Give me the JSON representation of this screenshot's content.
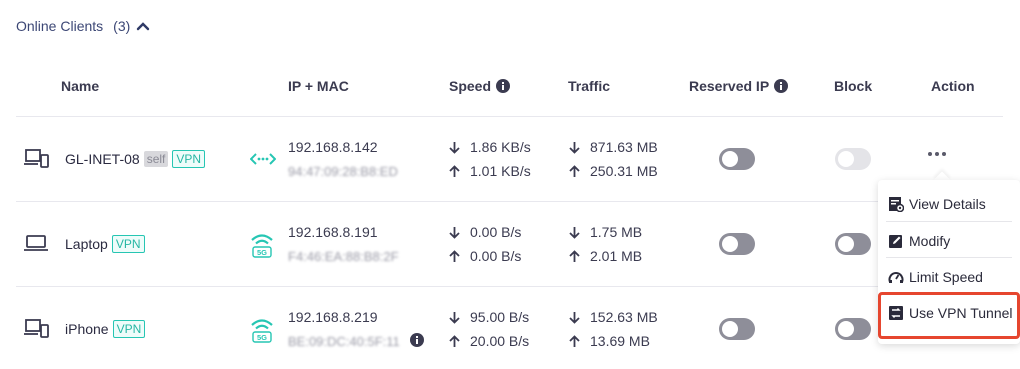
{
  "section": {
    "title": "Online Clients",
    "count": "(3)"
  },
  "columns": {
    "name": "Name",
    "ip_mac": "IP + MAC",
    "speed": "Speed",
    "traffic": "Traffic",
    "reserved_ip": "Reserved IP",
    "block": "Block",
    "action": "Action"
  },
  "clients": [
    {
      "device_type": "desktop-phone",
      "name": "GL-INET-08",
      "tags": [
        "self",
        "VPN"
      ],
      "connection": "lan",
      "ip": "192.168.8.142",
      "mac": "94:47:09:28:B8:ED",
      "speed_down": "1.86 KB/s",
      "speed_up": "1.01 KB/s",
      "traffic_down": "871.63 MB",
      "traffic_up": "250.31 MB",
      "reserved_ip": false,
      "block": "disabled"
    },
    {
      "device_type": "laptop",
      "name": "Laptop",
      "tags": [
        "VPN"
      ],
      "connection": "wifi-5g",
      "ip": "192.168.8.191",
      "mac": "F4:46:EA:88:B8:2F",
      "speed_down": "0.00 B/s",
      "speed_up": "0.00 B/s",
      "traffic_down": "1.75 MB",
      "traffic_up": "2.01 MB",
      "reserved_ip": false,
      "block": false
    },
    {
      "device_type": "desktop-phone",
      "name": "iPhone",
      "tags": [
        "VPN"
      ],
      "connection": "wifi-5g",
      "ip": "192.168.8.219",
      "mac": "BE:09:DC:40:5F:11",
      "speed_down": "95.00 B/s",
      "speed_up": "20.00 B/s",
      "traffic_down": "152.63 MB",
      "traffic_up": "13.69 MB",
      "reserved_ip": false,
      "block": false
    }
  ],
  "wifi_band_label": "5G",
  "menu": {
    "items": [
      {
        "label": "View Details",
        "icon": "details-icon"
      },
      {
        "label": "Modify",
        "icon": "edit-icon"
      },
      {
        "label": "Limit Speed",
        "icon": "speedometer-icon"
      },
      {
        "label": "Use VPN Tunnel",
        "icon": "vpn-tunnel-icon"
      }
    ],
    "highlight_color": "#e6462f"
  },
  "colors": {
    "accent": "#26c6b3",
    "text": "#3b3b50",
    "toggle_off": "#8e8e99"
  }
}
